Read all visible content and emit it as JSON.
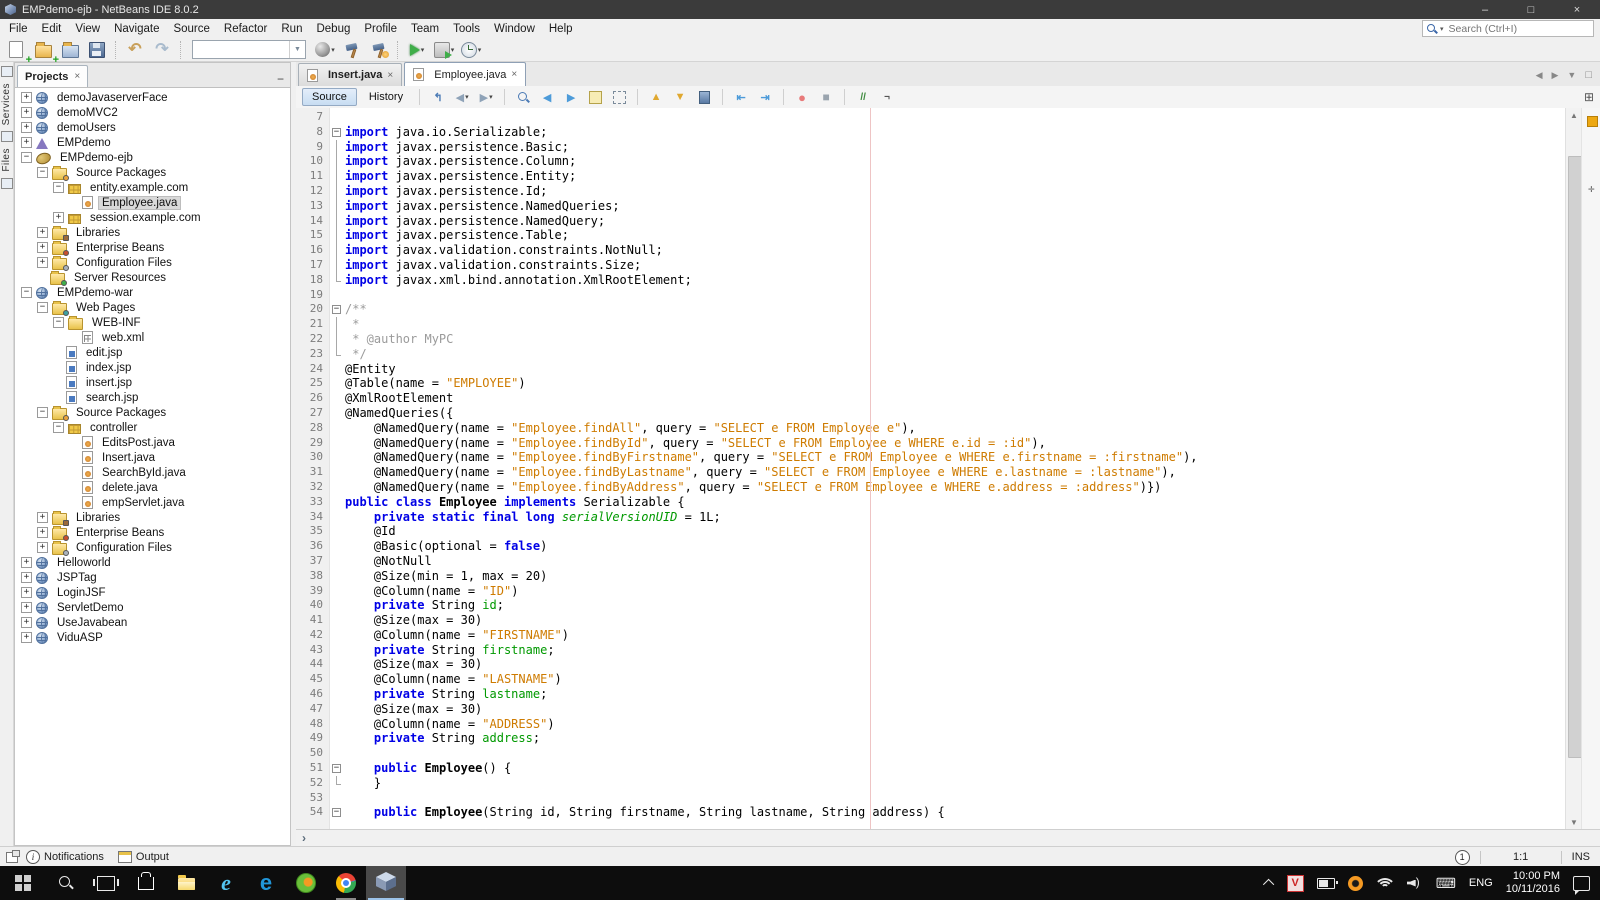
{
  "window": {
    "title": "EMPdemo-ejb - NetBeans IDE 8.0.2"
  },
  "menu": {
    "items": [
      "File",
      "Edit",
      "View",
      "Navigate",
      "Source",
      "Refactor",
      "Run",
      "Debug",
      "Profile",
      "Team",
      "Tools",
      "Window",
      "Help"
    ]
  },
  "search": {
    "placeholder": "Search (Ctrl+I)"
  },
  "main_toolbar": {
    "icons": [
      "new-file",
      "new-project",
      "open-project",
      "save-all",
      "undo",
      "redo",
      "configuration-select",
      "deploy",
      "build-project",
      "clean-and-build",
      "run-project",
      "debug-project",
      "profile-project"
    ]
  },
  "left_strip": {
    "tabs": [
      "Services",
      "Files"
    ]
  },
  "colors": {
    "keyword": "#0000e6",
    "string": "#ce7b00",
    "comment": "#9b9b9b",
    "field": "#009900",
    "margin_line": "#eec4c4",
    "warn_stripe": "#eda812"
  },
  "projects": {
    "title": "Projects",
    "tree": [
      {
        "d": 0,
        "i": "web",
        "e": "+",
        "t": "demoJavaserverFace"
      },
      {
        "d": 0,
        "i": "web",
        "e": "+",
        "t": "demoMVC2"
      },
      {
        "d": 0,
        "i": "web",
        "e": "+",
        "t": "demoUsers"
      },
      {
        "d": 0,
        "i": "ear",
        "e": "+",
        "t": "EMPdemo"
      },
      {
        "d": 0,
        "i": "ejb",
        "e": "-",
        "t": "EMPdemo-ejb"
      },
      {
        "d": 1,
        "i": "srcpkg",
        "e": "-",
        "t": "Source Packages"
      },
      {
        "d": 2,
        "i": "pkg",
        "e": "-",
        "t": "entity.example.com"
      },
      {
        "d": 3,
        "i": "java",
        "e": "",
        "t": "Employee.java",
        "sel": true
      },
      {
        "d": 2,
        "i": "pkg",
        "e": "+",
        "t": "session.example.com"
      },
      {
        "d": 1,
        "i": "lib",
        "e": "+",
        "t": "Libraries"
      },
      {
        "d": 1,
        "i": "beans",
        "e": "+",
        "t": "Enterprise Beans"
      },
      {
        "d": 1,
        "i": "conf",
        "e": "+",
        "t": "Configuration Files"
      },
      {
        "d": 1,
        "i": "server",
        "e": "",
        "t": "Server Resources"
      },
      {
        "d": 0,
        "i": "web",
        "e": "-",
        "t": "EMPdemo-war"
      },
      {
        "d": 1,
        "i": "webpages",
        "e": "-",
        "t": "Web Pages"
      },
      {
        "d": 2,
        "i": "folder",
        "e": "-",
        "t": "WEB-INF"
      },
      {
        "d": 3,
        "i": "xml",
        "e": "",
        "t": "web.xml"
      },
      {
        "d": 2,
        "i": "jsp",
        "e": "",
        "t": "edit.jsp"
      },
      {
        "d": 2,
        "i": "jsp",
        "e": "",
        "t": "index.jsp"
      },
      {
        "d": 2,
        "i": "jsp",
        "e": "",
        "t": "insert.jsp"
      },
      {
        "d": 2,
        "i": "jsp",
        "e": "",
        "t": "search.jsp"
      },
      {
        "d": 1,
        "i": "srcpkg",
        "e": "-",
        "t": "Source Packages"
      },
      {
        "d": 2,
        "i": "pkg",
        "e": "-",
        "t": "controller"
      },
      {
        "d": 3,
        "i": "java",
        "e": "",
        "t": "EditsPost.java"
      },
      {
        "d": 3,
        "i": "java",
        "e": "",
        "t": "Insert.java"
      },
      {
        "d": 3,
        "i": "java",
        "e": "",
        "t": "SearchById.java"
      },
      {
        "d": 3,
        "i": "java",
        "e": "",
        "t": "delete.java"
      },
      {
        "d": 3,
        "i": "java",
        "e": "",
        "t": "empServlet.java"
      },
      {
        "d": 1,
        "i": "lib",
        "e": "+",
        "t": "Libraries"
      },
      {
        "d": 1,
        "i": "beans",
        "e": "+",
        "t": "Enterprise Beans"
      },
      {
        "d": 1,
        "i": "conf",
        "e": "+",
        "t": "Configuration Files"
      },
      {
        "d": 0,
        "i": "web",
        "e": "+",
        "t": "Helloworld"
      },
      {
        "d": 0,
        "i": "web",
        "e": "+",
        "t": "JSPTag"
      },
      {
        "d": 0,
        "i": "web",
        "e": "+",
        "t": "LoginJSF"
      },
      {
        "d": 0,
        "i": "web",
        "e": "+",
        "t": "ServletDemo"
      },
      {
        "d": 0,
        "i": "web",
        "e": "+",
        "t": "UseJavabean"
      },
      {
        "d": 0,
        "i": "web",
        "e": "+",
        "t": "ViduASP"
      }
    ]
  },
  "editor": {
    "tabs": [
      {
        "label": "Insert.java",
        "modified": true,
        "selected": false
      },
      {
        "label": "Employee.java",
        "modified": false,
        "selected": true
      }
    ],
    "toolbar": {
      "source": "Source",
      "history": "History",
      "icons": [
        "jump-last-edit",
        "back",
        "forward",
        "find-selection",
        "prev-occurrence",
        "next-occurrence",
        "toggle-highlight",
        "rect-selection",
        "prev-bookmark",
        "next-bookmark",
        "toggle-bookmark",
        "shift-line-left",
        "shift-line-right",
        "record-macro",
        "stop-macro",
        "comment",
        "uncomment"
      ]
    },
    "code_lines": [
      {
        "n": 7,
        "f": "",
        "g": []
      },
      {
        "n": 8,
        "f": "s",
        "g": [
          [
            "kw",
            "import"
          ],
          [
            "pl",
            " java.io.Serializable;"
          ]
        ]
      },
      {
        "n": 9,
        "f": "m",
        "g": [
          [
            "kw",
            "import"
          ],
          [
            "pl",
            " javax.persistence.Basic;"
          ]
        ]
      },
      {
        "n": 10,
        "f": "m",
        "g": [
          [
            "kw",
            "import"
          ],
          [
            "pl",
            " javax.persistence.Column;"
          ]
        ]
      },
      {
        "n": 11,
        "f": "m",
        "g": [
          [
            "kw",
            "import"
          ],
          [
            "pl",
            " javax.persistence.Entity;"
          ]
        ]
      },
      {
        "n": 12,
        "f": "m",
        "g": [
          [
            "kw",
            "import"
          ],
          [
            "pl",
            " javax.persistence.Id;"
          ]
        ]
      },
      {
        "n": 13,
        "f": "m",
        "g": [
          [
            "kw",
            "import"
          ],
          [
            "pl",
            " javax.persistence.NamedQueries;"
          ]
        ]
      },
      {
        "n": 14,
        "f": "m",
        "g": [
          [
            "kw",
            "import"
          ],
          [
            "pl",
            " javax.persistence.NamedQuery;"
          ]
        ]
      },
      {
        "n": 15,
        "f": "m",
        "g": [
          [
            "kw",
            "import"
          ],
          [
            "pl",
            " javax.persistence.Table;"
          ]
        ]
      },
      {
        "n": 16,
        "f": "m",
        "g": [
          [
            "kw",
            "import"
          ],
          [
            "pl",
            " javax.validation.constraints.NotNull;"
          ]
        ]
      },
      {
        "n": 17,
        "f": "m",
        "g": [
          [
            "kw",
            "import"
          ],
          [
            "pl",
            " javax.validation.constraints.Size;"
          ]
        ]
      },
      {
        "n": 18,
        "f": "e",
        "g": [
          [
            "kw",
            "import"
          ],
          [
            "pl",
            " javax.xml.bind.annotation.XmlRootElement;"
          ]
        ]
      },
      {
        "n": 19,
        "f": "",
        "g": []
      },
      {
        "n": 20,
        "f": "s",
        "g": [
          [
            "com",
            "/**"
          ]
        ]
      },
      {
        "n": 21,
        "f": "m",
        "g": [
          [
            "com",
            " *"
          ]
        ]
      },
      {
        "n": 22,
        "f": "m",
        "g": [
          [
            "com",
            " * @author MyPC"
          ]
        ]
      },
      {
        "n": 23,
        "f": "e",
        "g": [
          [
            "com",
            " */"
          ]
        ]
      },
      {
        "n": 24,
        "f": "",
        "g": [
          [
            "pl",
            "@Entity"
          ]
        ]
      },
      {
        "n": 25,
        "f": "",
        "g": [
          [
            "pl",
            "@Table(name = "
          ],
          [
            "str",
            "\"EMPLOYEE\""
          ],
          [
            "pl",
            ")"
          ]
        ]
      },
      {
        "n": 26,
        "f": "",
        "g": [
          [
            "pl",
            "@XmlRootElement"
          ]
        ]
      },
      {
        "n": 27,
        "f": "",
        "g": [
          [
            "pl",
            "@NamedQueries({"
          ]
        ]
      },
      {
        "n": 28,
        "f": "",
        "g": [
          [
            "pl",
            "    @NamedQuery(name = "
          ],
          [
            "str",
            "\"Employee.findAll\""
          ],
          [
            "pl",
            ", query = "
          ],
          [
            "str",
            "\"SELECT e FROM Employee e\""
          ],
          [
            "pl",
            "),"
          ]
        ]
      },
      {
        "n": 29,
        "f": "",
        "g": [
          [
            "pl",
            "    @NamedQuery(name = "
          ],
          [
            "str",
            "\"Employee.findById\""
          ],
          [
            "pl",
            ", query = "
          ],
          [
            "str",
            "\"SELECT e FROM Employee e WHERE e.id = :id\""
          ],
          [
            "pl",
            "),"
          ]
        ]
      },
      {
        "n": 30,
        "f": "",
        "g": [
          [
            "pl",
            "    @NamedQuery(name = "
          ],
          [
            "str",
            "\"Employee.findByFirstname\""
          ],
          [
            "pl",
            ", query = "
          ],
          [
            "str",
            "\"SELECT e FROM Employee e WHERE e.firstname = :firstname\""
          ],
          [
            "pl",
            "),"
          ]
        ]
      },
      {
        "n": 31,
        "f": "",
        "g": [
          [
            "pl",
            "    @NamedQuery(name = "
          ],
          [
            "str",
            "\"Employee.findByLastname\""
          ],
          [
            "pl",
            ", query = "
          ],
          [
            "str",
            "\"SELECT e FROM Employee e WHERE e.lastname = :lastname\""
          ],
          [
            "pl",
            "),"
          ]
        ]
      },
      {
        "n": 32,
        "f": "",
        "g": [
          [
            "pl",
            "    @NamedQuery(name = "
          ],
          [
            "str",
            "\"Employee.findByAddress\""
          ],
          [
            "pl",
            ", query = "
          ],
          [
            "str",
            "\"SELECT e FROM Employee e WHERE e.address = :address\""
          ],
          [
            "pl",
            ")})"
          ]
        ]
      },
      {
        "n": 33,
        "f": "",
        "g": [
          [
            "kw",
            "public"
          ],
          [
            "pl",
            " "
          ],
          [
            "kw",
            "class"
          ],
          [
            "pl",
            " "
          ],
          [
            "cls",
            "Employee"
          ],
          [
            "pl",
            " "
          ],
          [
            "kw",
            "implements"
          ],
          [
            "pl",
            " Serializable {"
          ]
        ]
      },
      {
        "n": 34,
        "f": "",
        "g": [
          [
            "pl",
            "    "
          ],
          [
            "kw",
            "private"
          ],
          [
            "pl",
            " "
          ],
          [
            "kw",
            "static"
          ],
          [
            "pl",
            " "
          ],
          [
            "kw",
            "final"
          ],
          [
            "pl",
            " "
          ],
          [
            "kw",
            "long"
          ],
          [
            "pl",
            " "
          ],
          [
            "sfld",
            "serialVersionUID"
          ],
          [
            "pl",
            " = 1L;"
          ]
        ]
      },
      {
        "n": 35,
        "f": "",
        "g": [
          [
            "pl",
            "    @Id"
          ]
        ]
      },
      {
        "n": 36,
        "f": "",
        "g": [
          [
            "pl",
            "    @Basic(optional = "
          ],
          [
            "kw",
            "false"
          ],
          [
            "pl",
            ")"
          ]
        ]
      },
      {
        "n": 37,
        "f": "",
        "g": [
          [
            "pl",
            "    @NotNull"
          ]
        ]
      },
      {
        "n": 38,
        "f": "",
        "g": [
          [
            "pl",
            "    @Size(min = 1, max = 20)"
          ]
        ]
      },
      {
        "n": 39,
        "f": "",
        "g": [
          [
            "pl",
            "    @Column(name = "
          ],
          [
            "str",
            "\"ID\""
          ],
          [
            "pl",
            ")"
          ]
        ]
      },
      {
        "n": 40,
        "f": "",
        "g": [
          [
            "pl",
            "    "
          ],
          [
            "kw",
            "private"
          ],
          [
            "pl",
            " String "
          ],
          [
            "fld",
            "id"
          ],
          [
            "pl",
            ";"
          ]
        ]
      },
      {
        "n": 41,
        "f": "",
        "g": [
          [
            "pl",
            "    @Size(max = 30)"
          ]
        ]
      },
      {
        "n": 42,
        "f": "",
        "g": [
          [
            "pl",
            "    @Column(name = "
          ],
          [
            "str",
            "\"FIRSTNAME\""
          ],
          [
            "pl",
            ")"
          ]
        ]
      },
      {
        "n": 43,
        "f": "",
        "g": [
          [
            "pl",
            "    "
          ],
          [
            "kw",
            "private"
          ],
          [
            "pl",
            " String "
          ],
          [
            "fld",
            "firstname"
          ],
          [
            "pl",
            ";"
          ]
        ]
      },
      {
        "n": 44,
        "f": "",
        "g": [
          [
            "pl",
            "    @Size(max = 30)"
          ]
        ]
      },
      {
        "n": 45,
        "f": "",
        "g": [
          [
            "pl",
            "    @Column(name = "
          ],
          [
            "str",
            "\"LASTNAME\""
          ],
          [
            "pl",
            ")"
          ]
        ]
      },
      {
        "n": 46,
        "f": "",
        "g": [
          [
            "pl",
            "    "
          ],
          [
            "kw",
            "private"
          ],
          [
            "pl",
            " String "
          ],
          [
            "fld",
            "lastname"
          ],
          [
            "pl",
            ";"
          ]
        ]
      },
      {
        "n": 47,
        "f": "",
        "g": [
          [
            "pl",
            "    @Size(max = 30)"
          ]
        ]
      },
      {
        "n": 48,
        "f": "",
        "g": [
          [
            "pl",
            "    @Column(name = "
          ],
          [
            "str",
            "\"ADDRESS\""
          ],
          [
            "pl",
            ")"
          ]
        ]
      },
      {
        "n": 49,
        "f": "",
        "g": [
          [
            "pl",
            "    "
          ],
          [
            "kw",
            "private"
          ],
          [
            "pl",
            " String "
          ],
          [
            "fld",
            "address"
          ],
          [
            "pl",
            ";"
          ]
        ]
      },
      {
        "n": 50,
        "f": "",
        "g": []
      },
      {
        "n": 51,
        "f": "s",
        "g": [
          [
            "pl",
            "    "
          ],
          [
            "kw",
            "public"
          ],
          [
            "pl",
            " "
          ],
          [
            "cls",
            "Employee"
          ],
          [
            "pl",
            "() {"
          ]
        ]
      },
      {
        "n": 52,
        "f": "e",
        "g": [
          [
            "pl",
            "    }"
          ]
        ]
      },
      {
        "n": 53,
        "f": "",
        "g": []
      },
      {
        "n": 54,
        "f": "s",
        "g": [
          [
            "pl",
            "    "
          ],
          [
            "kw",
            "public"
          ],
          [
            "pl",
            " "
          ],
          [
            "cls",
            "Employee"
          ],
          [
            "pl",
            "(String id, String firstname, String lastname, String address) {"
          ]
        ]
      }
    ]
  },
  "statusbar": {
    "notifications": "Notifications",
    "output": "Output",
    "badge": "1",
    "caret": "1:1",
    "insert_mode": "INS"
  },
  "taskbar": {
    "icons": [
      "start",
      "search",
      "task-view",
      "store",
      "file-explorer",
      "internet-explorer",
      "edge",
      "green-app",
      "chrome",
      "netbeans"
    ],
    "tray": [
      "tray-expand",
      "tray-v-app",
      "battery",
      "tray-orange-app",
      "wifi",
      "volume",
      "touch-keyboard"
    ],
    "language": "ENG",
    "time": "10:00 PM",
    "date": "10/11/2016"
  }
}
